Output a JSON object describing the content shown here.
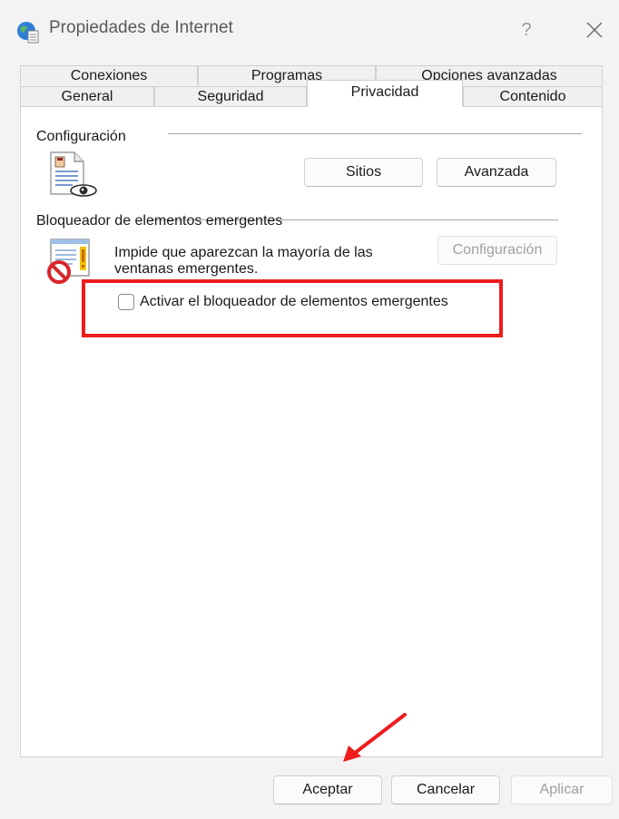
{
  "window": {
    "title": "Propiedades de Internet",
    "help_glyph": "?",
    "app_icon": "globe-document-icon",
    "close_icon": "close-icon"
  },
  "tabs": {
    "row1": [
      {
        "label": "Conexiones"
      },
      {
        "label": "Programas"
      },
      {
        "label": "Opciones avanzadas"
      }
    ],
    "row2": [
      {
        "label": "General"
      },
      {
        "label": "Seguridad"
      },
      {
        "label": "Privacidad",
        "active": true
      },
      {
        "label": "Contenido"
      }
    ]
  },
  "settings_group": {
    "label": "Configuración",
    "icon": "privacy-document-eye-icon",
    "sites_button": "Sitios",
    "advanced_button": "Avanzada"
  },
  "popup_group": {
    "label": "Bloqueador de elementos emergentes",
    "icon": "popup-blocked-icon",
    "description_line1": "Impide que aparezcan la mayoría de las",
    "description_line2": "ventanas emergentes.",
    "config_button": "Configuración",
    "config_button_enabled": false,
    "checkbox_label": "Activar el bloqueador de elementos emergentes",
    "checkbox_checked": false
  },
  "annotations": {
    "highlight_color": "#ee1c1c",
    "arrow_color": "#ee1c1c"
  },
  "footer": {
    "ok_button": "Aceptar",
    "cancel_button": "Cancelar",
    "apply_button": "Aplicar",
    "apply_enabled": false
  }
}
